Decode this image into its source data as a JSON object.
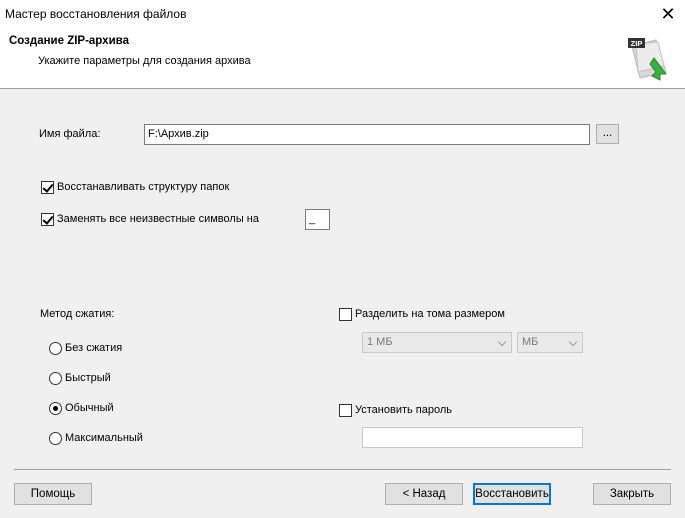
{
  "window": {
    "title": "Мастер восстановления файлов",
    "close": "✕"
  },
  "header": {
    "title": "Создание ZIP-архива",
    "subtitle": "Укажите параметры для создания архива",
    "icon": "zip-archive-icon",
    "icon_label": "ZIP"
  },
  "file": {
    "label": "Имя файла:",
    "value": "F:\\Архив.zip",
    "browse_label": "..."
  },
  "options": {
    "restore_structure": {
      "label": "Восстанавливать структуру папок",
      "checked": true
    },
    "replace_unknown": {
      "label": "Заменять все неизвестные символы на",
      "checked": true,
      "value": "_"
    }
  },
  "compression": {
    "label": "Метод сжатия:",
    "methods": [
      {
        "label": "Без сжатия",
        "selected": false
      },
      {
        "label": "Быстрый",
        "selected": false
      },
      {
        "label": "Обычный",
        "selected": true
      },
      {
        "label": "Максимальный",
        "selected": false
      }
    ]
  },
  "split": {
    "label": "Разделить на тома размером",
    "checked": false,
    "size_value": "1 МБ",
    "unit_value": "МБ"
  },
  "password": {
    "label": "Установить пароль",
    "checked": false,
    "value": ""
  },
  "buttons": {
    "help": "Помощь",
    "back": "< Назад",
    "restore": "Восстановить",
    "close": "Закрыть"
  },
  "colors": {
    "accent": "#0078d7",
    "zip_arrow": "#3cb043"
  }
}
